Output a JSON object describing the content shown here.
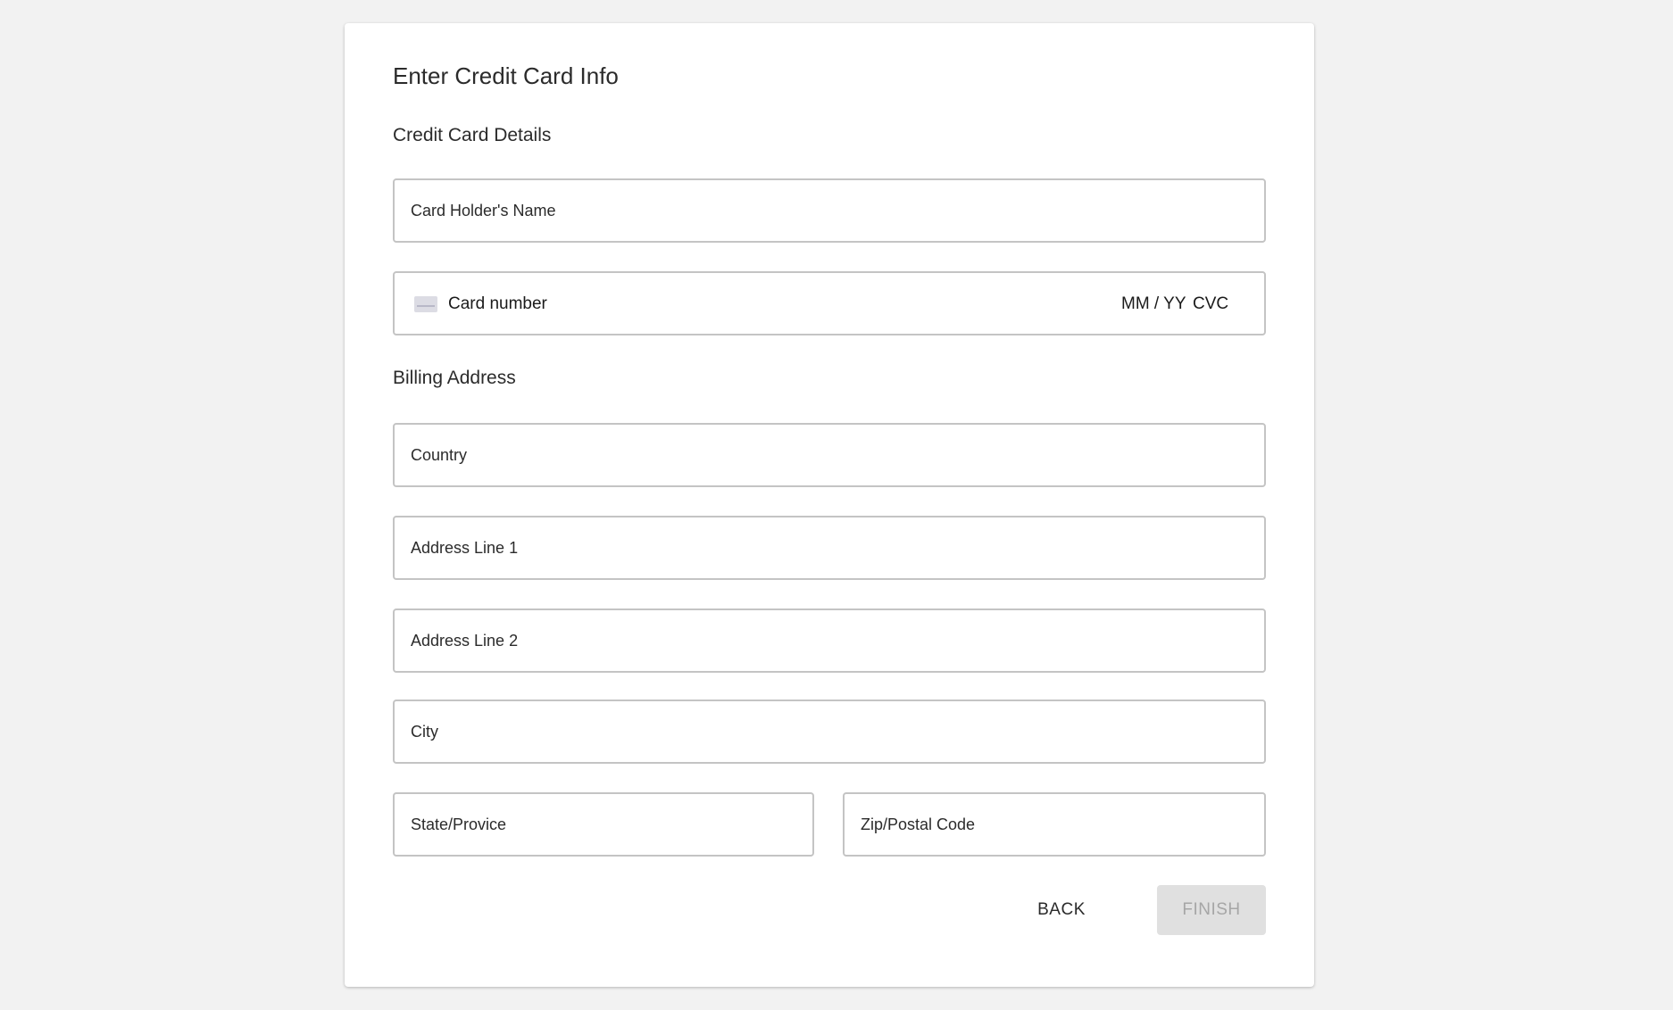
{
  "form": {
    "title": "Enter Credit Card Info",
    "credit_section_title": "Credit Card Details",
    "billing_section_title": "Billing Address"
  },
  "fields": {
    "cardholder_name": {
      "placeholder": "Card Holder's Name",
      "value": ""
    },
    "card_number": {
      "placeholder": "Card number",
      "value": ""
    },
    "expiry": {
      "placeholder": "MM / YY",
      "value": ""
    },
    "cvc": {
      "placeholder": "CVC",
      "value": ""
    },
    "country": {
      "placeholder": "Country",
      "value": ""
    },
    "address_line_1": {
      "placeholder": "Address Line 1",
      "value": ""
    },
    "address_line_2": {
      "placeholder": "Address Line 2",
      "value": ""
    },
    "city": {
      "placeholder": "City",
      "value": ""
    },
    "state": {
      "placeholder": "State/Provice",
      "value": ""
    },
    "zip": {
      "placeholder": "Zip/Postal Code",
      "value": ""
    }
  },
  "icons": {
    "card_icon": "credit-card-icon"
  },
  "buttons": {
    "back_label": "BACK",
    "finish_label": "FINISH",
    "finish_disabled": true
  },
  "colors": {
    "background": "#f2f2f2",
    "card": "#ffffff",
    "field_border": "#c4c4c4",
    "text": "#2b2b2b",
    "finish_bg_disabled": "#e0e0e0",
    "finish_text_disabled": "#a6a6a6"
  }
}
